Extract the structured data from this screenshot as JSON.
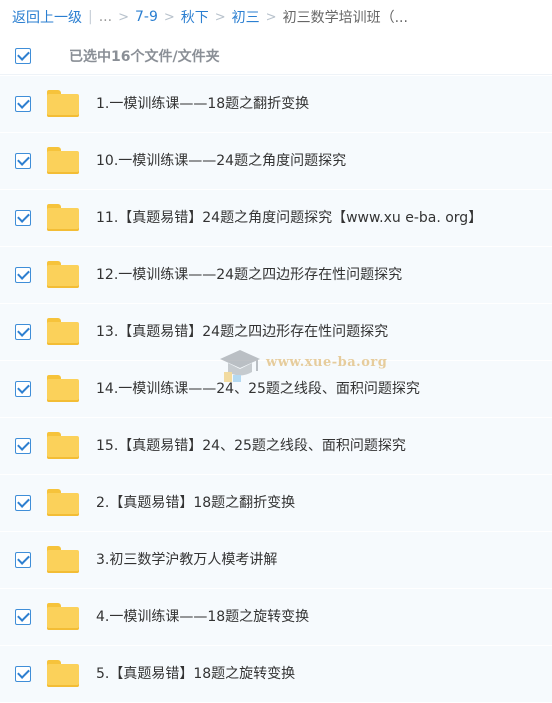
{
  "breadcrumb": {
    "back_label": "返回上一级",
    "ellipsis": "...",
    "crumbs": [
      "7-9",
      "秋下",
      "初三"
    ],
    "current": "初三数学培训班（..."
  },
  "selection": {
    "label": "已选中16个文件/文件夹"
  },
  "files": [
    {
      "name": "1.一模训练课——18题之翻折变换"
    },
    {
      "name": "10.一模训练课——24题之角度问题探究"
    },
    {
      "name": "11.【真题易错】24题之角度问题探究【www.xu e-ba. org】"
    },
    {
      "name": "12.一模训练课——24题之四边形存在性问题探究"
    },
    {
      "name": "13.【真题易错】24题之四边形存在性问题探究"
    },
    {
      "name": "14.一模训练课——24、25题之线段、面积问题探究"
    },
    {
      "name": "15.【真题易错】24、25题之线段、面积问题探究"
    },
    {
      "name": "2.【真题易错】18题之翻折变换"
    },
    {
      "name": "3.初三数学沪教万人模考讲解"
    },
    {
      "name": "4.一模训练课——18题之旋转变换"
    },
    {
      "name": "5.【真题易错】18题之旋转变换"
    }
  ],
  "watermark": {
    "text": "www.xue-ba.org"
  },
  "colors": {
    "link": "#2b7fd1",
    "row_bg": "#f6fafd",
    "folder": "#fbd15a",
    "checkbox": "#3f8ed8"
  }
}
